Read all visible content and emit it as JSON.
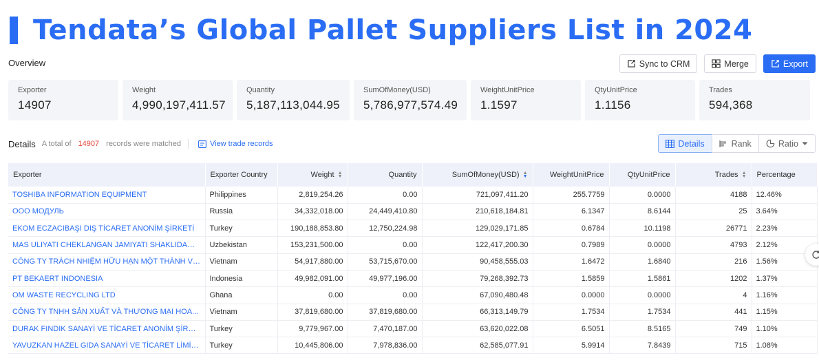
{
  "title": "Tendata’s Global Pallet Suppliers List in 2024",
  "overview_label": "Overview",
  "toolbar": {
    "sync_label": "Sync to CRM",
    "merge_label": "Merge",
    "export_label": "Export"
  },
  "stats": [
    {
      "label": "Exporter",
      "value": "14907"
    },
    {
      "label": "Weight",
      "value": "4,990,197,411.57"
    },
    {
      "label": "Quantity",
      "value": "5,187,113,044.95"
    },
    {
      "label": "SumOfMoney(USD)",
      "value": "5,786,977,574.49"
    },
    {
      "label": "WeightUnitPrice",
      "value": "1.1597"
    },
    {
      "label": "QtyUnitPrice",
      "value": "1.1156"
    },
    {
      "label": "Trades",
      "value": "594,368"
    }
  ],
  "details": {
    "label": "Details",
    "prefix": "A total of",
    "count": "14907",
    "suffix": "records were matched",
    "view_link": "View trade records"
  },
  "views": {
    "details": "Details",
    "rank": "Rank",
    "ratio": "Ratio"
  },
  "table": {
    "headers": [
      "Exporter",
      "Exporter Country",
      "Weight",
      "Quantity",
      "SumOfMoney(USD)",
      "WeightUnitPrice",
      "QtyUnitPrice",
      "Trades",
      "Percentage"
    ],
    "rows": [
      [
        "TOSHIBA INFORMATION EQUIPMENT",
        "Philippines",
        "2,819,254.26",
        "0.00",
        "721,097,411.20",
        "255.7759",
        "0.0000",
        "4188",
        "12.46%"
      ],
      [
        "ООО МОДУЛЬ",
        "Russia",
        "34,332,018.00",
        "24,449,410.80",
        "210,618,184.81",
        "6.1347",
        "8.6144",
        "25",
        "3.64%"
      ],
      [
        "EKOM ECZACIBAŞI DIŞ TİCARET ANONİM ŞİRKETİ",
        "Turkey",
        "190,188,853.80",
        "12,750,224.98",
        "129,029,171.85",
        "0.6784",
        "10.1198",
        "26771",
        "2.23%"
      ],
      [
        "MAS ULIYATI CHEKLANGAN JAMIYATI SHAKLIDAGI UZ KO...",
        "Uzbekistan",
        "153,231,500.00",
        "0.00",
        "122,417,200.30",
        "0.7989",
        "0.0000",
        "4793",
        "2.12%"
      ],
      [
        "CÔNG TY TRÁCH NHIỆM HỮU HẠN MỘT THÀNH VIÊN ĐỨC...",
        "Vietnam",
        "54,917,880.00",
        "53,715,670.00",
        "90,458,555.03",
        "1.6472",
        "1.6840",
        "216",
        "1.56%"
      ],
      [
        "PT BEKAERT INDONESIA",
        "Indonesia",
        "49,982,091.00",
        "49,977,196.00",
        "79,268,392.73",
        "1.5859",
        "1.5861",
        "1202",
        "1.37%"
      ],
      [
        "OM WASTE RECYCLING LTD",
        "Ghana",
        "0.00",
        "0.00",
        "67,090,480.48",
        "0.0000",
        "0.0000",
        "4",
        "1.16%"
      ],
      [
        "CÔNG TY TNHH SẢN XUẤT VÀ THƯƠNG MẠI HOA SEN VÀ...",
        "Vietnam",
        "37,819,680.00",
        "37,819,680.00",
        "66,313,149.79",
        "1.7534",
        "1.7534",
        "441",
        "1.15%"
      ],
      [
        "DURAK FINDIK SANAYİ VE TİCARET ANONİM ŞİRKETİ",
        "Turkey",
        "9,779,967.00",
        "7,470,187.00",
        "63,620,022.08",
        "6.5051",
        "8.5165",
        "749",
        "1.10%"
      ],
      [
        "YAVUZKAN HAZEL GIDA SANAYİ VE TİCARET LİMİTED ŞİR...",
        "Turkey",
        "10,445,806.00",
        "7,978,836.00",
        "62,585,077.91",
        "5.9914",
        "7.8439",
        "715",
        "1.08%"
      ]
    ]
  },
  "colors": {
    "accent": "#2a6df4",
    "count": "#e8453c",
    "header_bg": "#eef1fa",
    "stat_bg": "#f4f5f8"
  },
  "icons": {
    "sync": "sync-crm-icon",
    "merge": "merge-icon",
    "export": "export-icon",
    "details": "table-icon",
    "rank": "rank-icon",
    "ratio": "ratio-icon",
    "view": "trade-records-icon",
    "float": "refresh-icon"
  }
}
